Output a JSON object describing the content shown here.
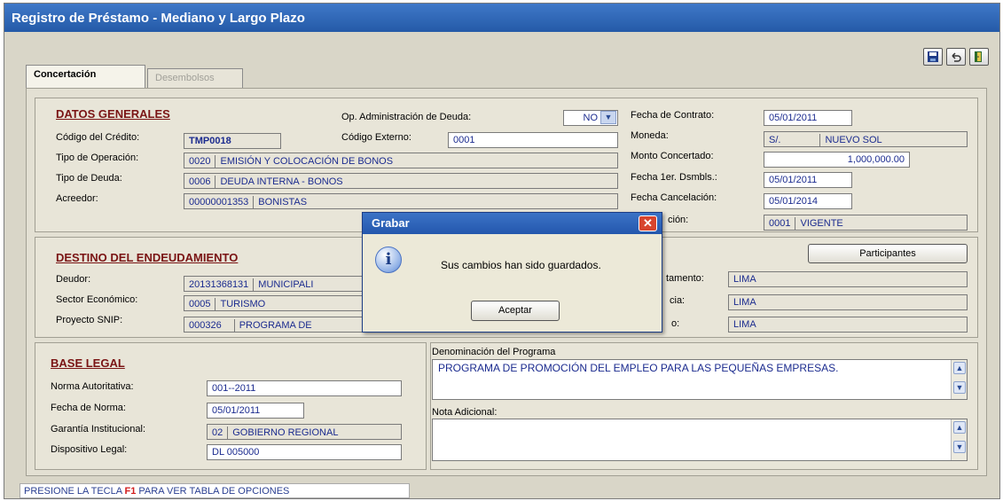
{
  "window": {
    "title": "Registro de Préstamo - Mediano y Largo Plazo"
  },
  "tabs": [
    {
      "label": "Concertación"
    },
    {
      "label": "Desembolsos"
    }
  ],
  "toolbar": {
    "save_icon": "floppy-disk-icon",
    "undo_icon": "undo-icon",
    "exit_icon": "exit-door-icon"
  },
  "datos_generales": {
    "heading": "DATOS GENERALES",
    "op_admin_label": "Op. Administración de Deuda:",
    "op_admin_value": "NO",
    "codigo_credito_label": "Código del Crédito:",
    "codigo_credito_value": "TMP0018",
    "codigo_externo_label": "Código Externo:",
    "codigo_externo_value": "0001",
    "tipo_operacion_label": "Tipo de Operación:",
    "tipo_operacion_code": "0020",
    "tipo_operacion_desc": "EMISIÓN Y COLOCACIÓN DE BONOS",
    "tipo_deuda_label": "Tipo de Deuda:",
    "tipo_deuda_code": "0006",
    "tipo_deuda_desc": "DEUDA INTERNA - BONOS",
    "acreedor_label": "Acreedor:",
    "acreedor_code": "00000001353",
    "acreedor_desc": "BONISTAS",
    "fecha_contrato_label": "Fecha de Contrato:",
    "fecha_contrato_value": "05/01/2011",
    "moneda_label": "Moneda:",
    "moneda_code": "S/.",
    "moneda_desc": "NUEVO SOL",
    "monto_label": "Monto Concertado:",
    "monto_value": "1,000,000.00",
    "fecha_1er_label": "Fecha 1er. Dsmbls.:",
    "fecha_1er_value": "05/01/2011",
    "fecha_cancel_label": "Fecha Cancelación:",
    "fecha_cancel_value": "05/01/2014",
    "situacion_label_partial": "ción:",
    "situacion_code": "0001",
    "situacion_desc": "VIGENTE"
  },
  "destino": {
    "heading": "DESTINO DEL ENDEUDAMIENTO",
    "participantes_button": "Participantes",
    "deudor_label": "Deudor:",
    "deudor_code": "20131368131",
    "deudor_desc": "MUNICIPALI",
    "sector_label": "Sector Económico:",
    "sector_code": "0005",
    "sector_desc": "TURISMO",
    "proyecto_label": "Proyecto SNIP:",
    "proyecto_code": "000326",
    "proyecto_desc": "PROGRAMA DE",
    "departamento_label_partial": "tamento:",
    "departamento_value": "LIMA",
    "provincia_label_partial": "cia:",
    "provincia_value": "LIMA",
    "distrito_label_partial": "o:",
    "distrito_value": "LIMA"
  },
  "base_legal": {
    "heading": "BASE LEGAL",
    "norma_label": "Norma Autoritativa:",
    "norma_value": "001--2011",
    "fecha_norma_label": "Fecha de Norma:",
    "fecha_norma_value": "05/01/2011",
    "garantia_label": "Garantía Institucional:",
    "garantia_code": "02",
    "garantia_desc": "GOBIERNO REGIONAL",
    "dispositivo_label": "Dispositivo Legal:",
    "dispositivo_value": "DL 005000"
  },
  "programa": {
    "denominacion_label": "Denominación del Programa",
    "denominacion_value": "PROGRAMA DE PROMOCIÓN  DEL EMPLEO PARA LAS PEQUEÑAS EMPRESAS.",
    "nota_label": "Nota Adicional:",
    "nota_value": ""
  },
  "dialog": {
    "title": "Grabar",
    "close": "✕",
    "message": "Sus cambios han sido guardados.",
    "button": "Aceptar",
    "icon": "info-icon"
  },
  "status": {
    "prefix": "PRESIONE LA TECLA ",
    "key": "F1",
    "suffix": " PARA VER TABLA DE OPCIONES"
  },
  "colors": {
    "title_bar": "#2c62b5",
    "field_text": "#1b2b8f",
    "section_heading": "#7a1414",
    "key_highlight": "#d21d1d"
  }
}
